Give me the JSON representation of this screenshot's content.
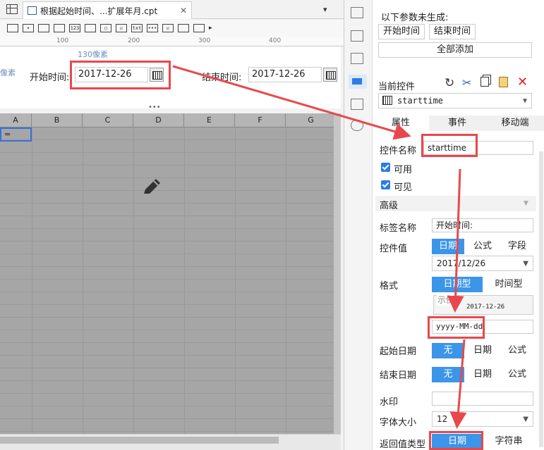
{
  "tab": {
    "title": "根据起始时间、...扩展年月.cpt"
  },
  "ruler": {
    "ticks": [
      "100",
      "200",
      "300",
      "400"
    ],
    "width_label": "130像素",
    "left_clip": "像素"
  },
  "form": {
    "start_label": "开始时间:",
    "start_value": "2017-12-26",
    "end_label": "结束时间:",
    "end_value": "2017-12-26"
  },
  "grid": {
    "columns": [
      "A",
      "B",
      "C",
      "D",
      "E",
      "F",
      "G"
    ],
    "cell_a1": "="
  },
  "params": {
    "title": "以下参数未生成:",
    "items": [
      "开始时间",
      "结束时间"
    ],
    "add_all": "全部添加"
  },
  "control": {
    "current_label": "当前控件",
    "current_value": "starttime",
    "tabs": [
      "属性",
      "事件",
      "移动端"
    ]
  },
  "props": {
    "name_label": "控件名称",
    "name_value": "starttime",
    "enabled_label": "可用",
    "visible_label": "可见",
    "advanced_label": "高级",
    "tag_label": "标签名称",
    "tag_value": "开始时间:",
    "value_label": "控件值",
    "value_options": [
      "日期",
      "公式",
      "字段"
    ],
    "value_date": "2017/12/26",
    "format_label": "格式",
    "format_options": [
      "日期型",
      "时间型"
    ],
    "example_label": "示例",
    "example_value": "2017-12-26",
    "format_pattern": "yyyy-MM-dd",
    "start_date_label": "起始日期",
    "start_date_options": [
      "无",
      "日期",
      "公式"
    ],
    "end_date_label": "结束日期",
    "end_date_options": [
      "无",
      "日期",
      "公式"
    ],
    "watermark_label": "水印",
    "fontsize_label": "字体大小",
    "fontsize_value": "12",
    "return_label": "返回值类型",
    "return_options": [
      "日期",
      "字符串"
    ]
  },
  "colors": {
    "accent": "#3b95e8",
    "highlight": "#e8484d",
    "grid": "#a6a6a6"
  }
}
